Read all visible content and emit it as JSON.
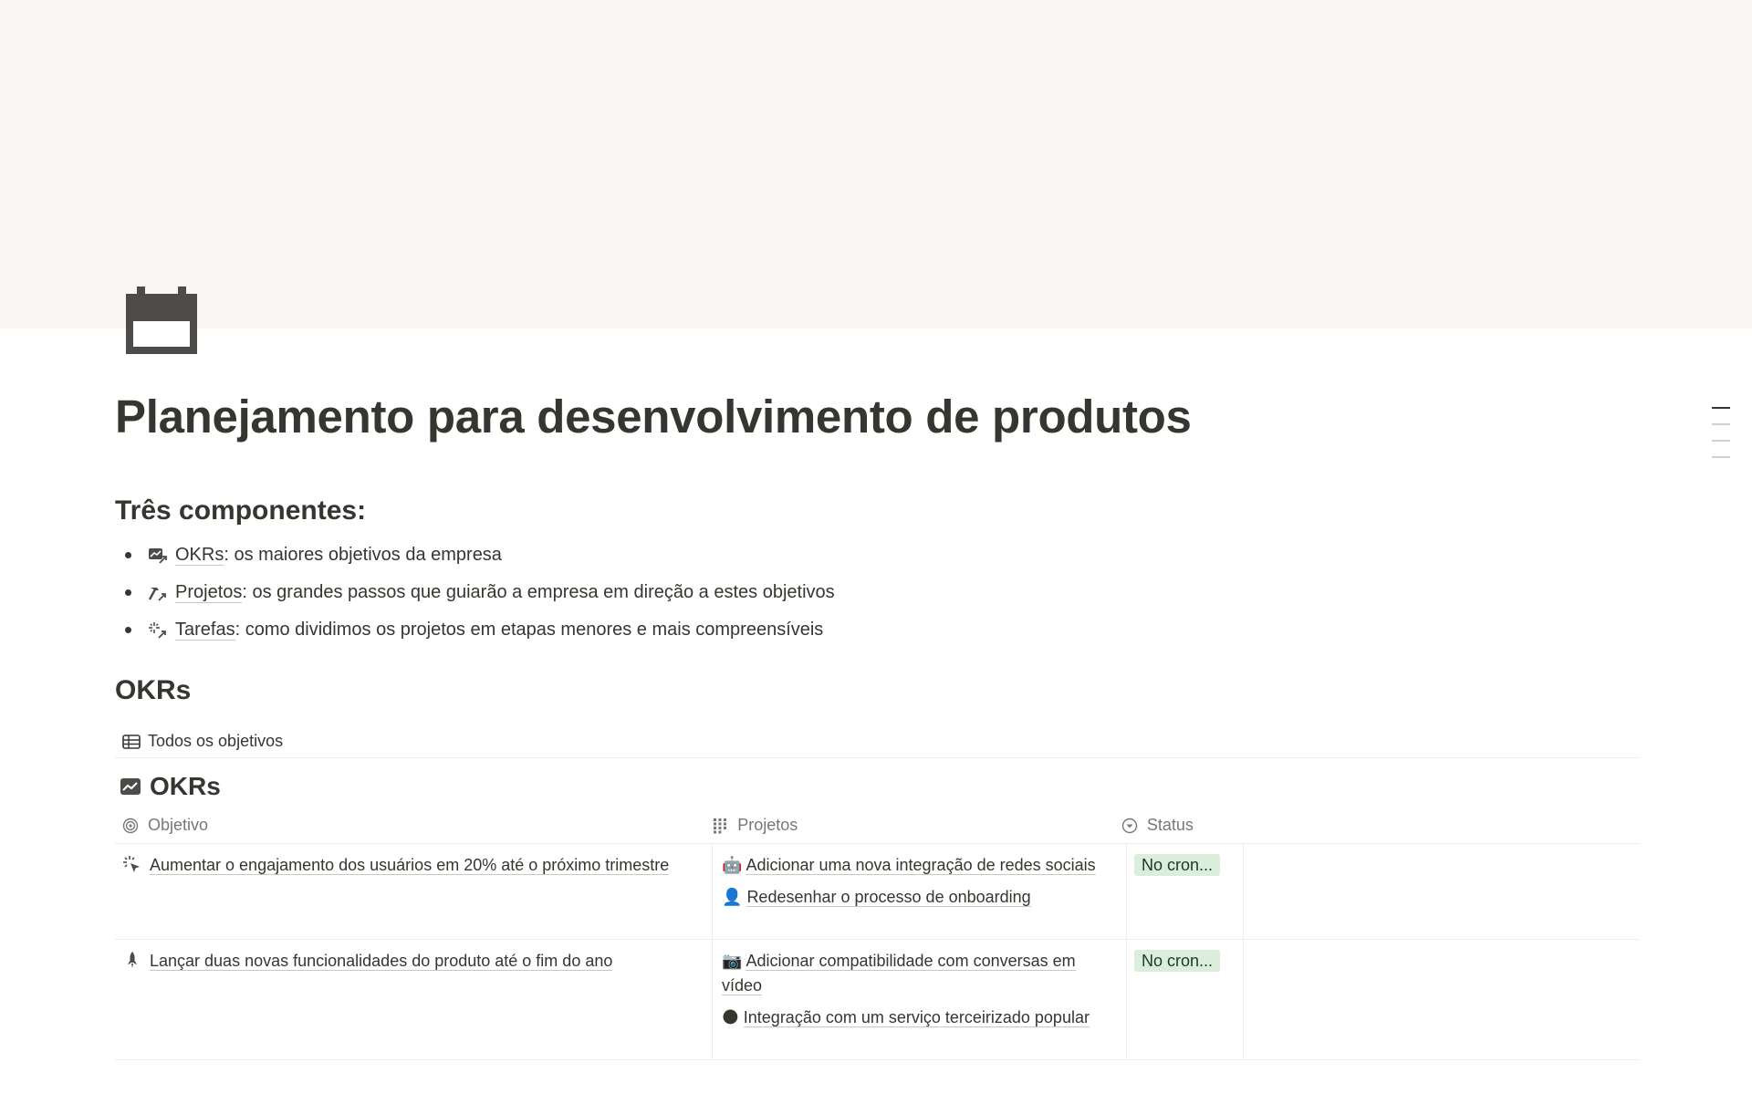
{
  "page": {
    "title": "Planejamento para desenvolvimento de produtos",
    "icon": "calendar-icon",
    "cover_color": "#faf6f3"
  },
  "components": {
    "heading": "Três componentes:",
    "items": [
      {
        "icon": "chart-arrow-icon",
        "link": "OKRs",
        "text": ": os maiores objetivos da empresa"
      },
      {
        "icon": "hammer-arrow-icon",
        "link": "Projetos",
        "text": ": os grandes passos que guiarão a empresa em direção a estes objetivos"
      },
      {
        "icon": "sparkle-arrow-icon",
        "link": "Tarefas",
        "text": ": como dividimos os projetos em etapas menores e mais compreensíveis"
      }
    ]
  },
  "okrs_section": {
    "heading": "OKRs",
    "view_tab": "Todos os objetivos",
    "database_title": "OKRs",
    "columns": {
      "objective": "Objetivo",
      "projects": "Projetos",
      "status": "Status"
    },
    "rows": [
      {
        "icon": "sparkle-cursor-icon",
        "objective": "Aumentar o engajamento dos usuários em 20% até o próximo trimestre",
        "projects": [
          {
            "emoji": "🤖",
            "name": "Adicionar uma nova integração de redes sociais"
          },
          {
            "emoji": "👤",
            "name": "Redesenhar o processo de onboarding"
          }
        ],
        "status": "No cron..."
      },
      {
        "icon": "rocket-icon",
        "objective": "Lançar duas novas funcionalidades do produto até o fim do ano",
        "projects": [
          {
            "emoji": "📷",
            "name": "Adicionar compatibilidade com conversas em vídeo"
          },
          {
            "emoji": "🌑",
            "name": "Integração com um serviço terceirizado popular"
          }
        ],
        "status": "No cron..."
      }
    ]
  },
  "colors": {
    "text": "#37352f",
    "muted": "#787774",
    "status_bg": "#dbeddb",
    "status_text": "#1c3829"
  }
}
